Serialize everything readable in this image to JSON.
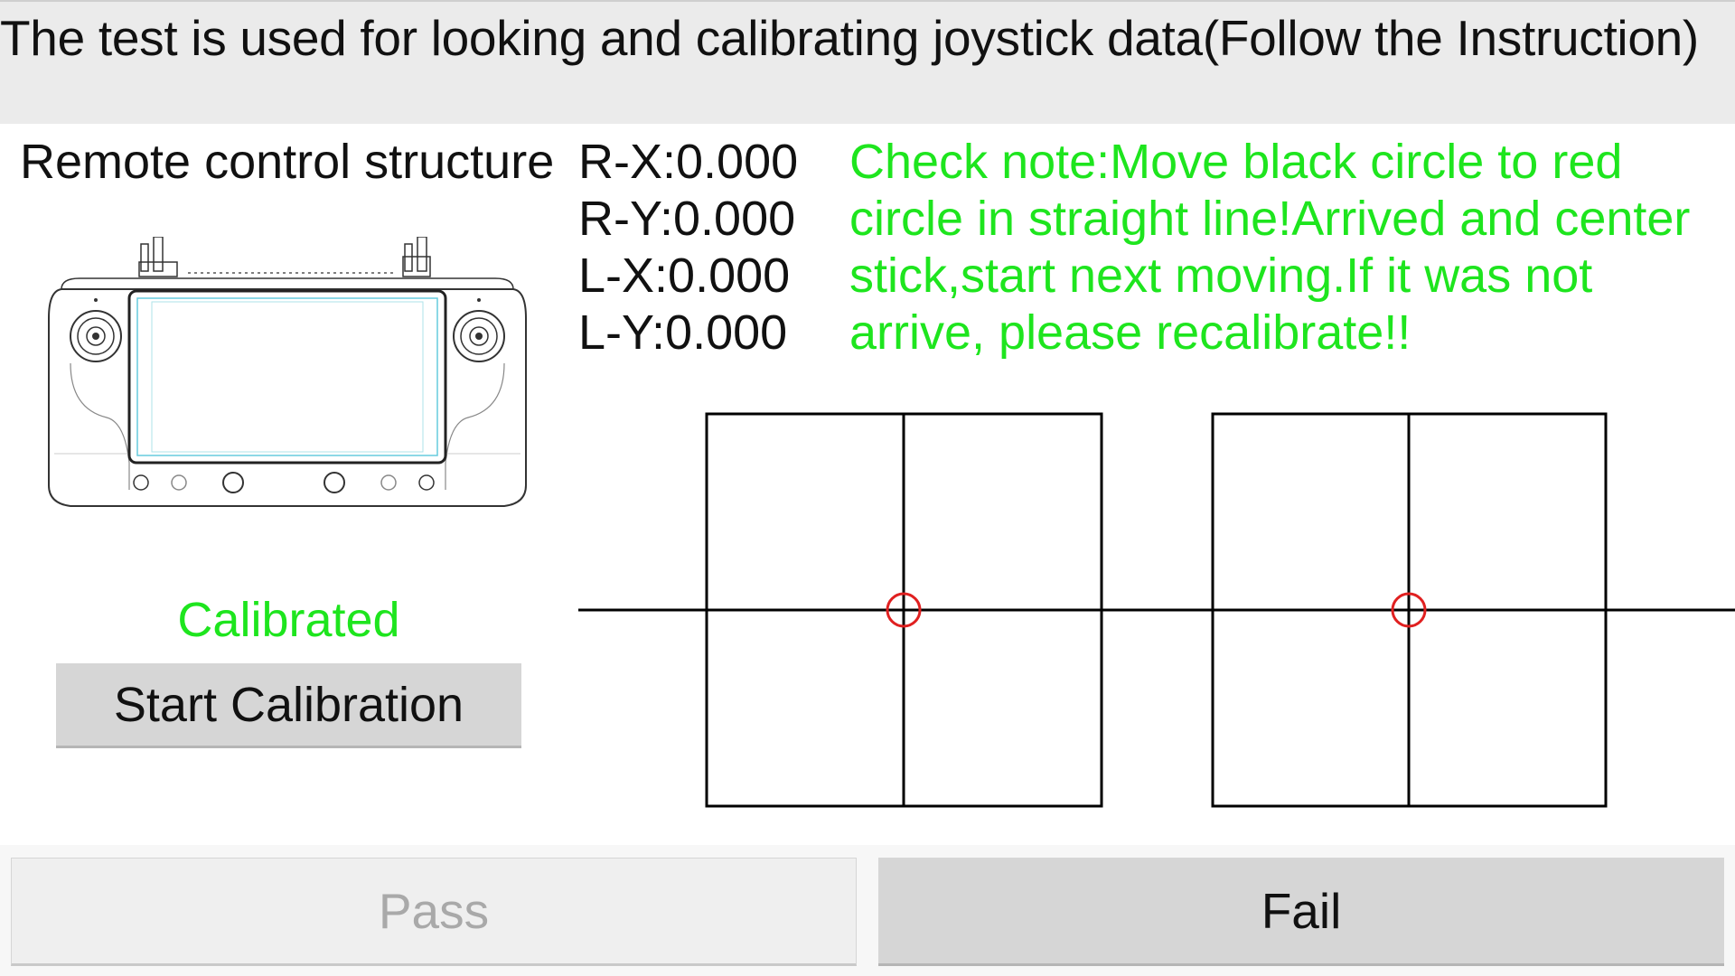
{
  "header": {
    "title": "The test is used for looking and calibrating joystick data(Follow the Instruction)"
  },
  "left_panel": {
    "structure_title": "Remote control structure",
    "image_icon": "remote-controller-illustration",
    "status": "Calibrated",
    "start_button": "Start Calibration"
  },
  "axes": {
    "rx": "R-X:0.000",
    "ry": "R-Y:0.000",
    "lx": "L-X:0.000",
    "ly": "L-Y:0.000"
  },
  "check_note": "Check note:Move black circle to red circle in straight line!Arrived and center stick,start next moving.If it was not arrive, please recalibrate!!",
  "joysticks": {
    "right": {
      "x": 0.0,
      "y": 0.0
    },
    "left": {
      "x": 0.0,
      "y": 0.0
    },
    "target_color": "#e02020",
    "grid_color": "#000000"
  },
  "footer": {
    "pass_button": "Pass",
    "pass_enabled": false,
    "fail_button": "Fail"
  },
  "colors": {
    "status_green": "#1ee51e",
    "header_bg": "#ebebeb",
    "button_bg": "#d6d6d6"
  }
}
